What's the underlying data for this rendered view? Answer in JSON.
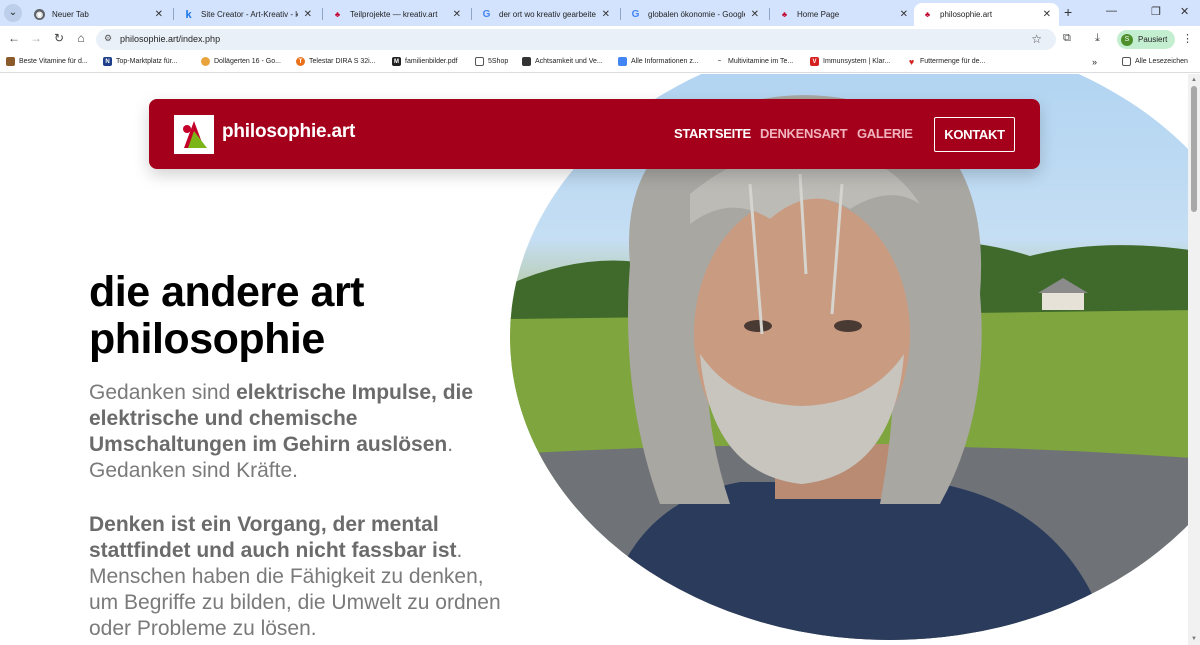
{
  "browser": {
    "tabs": [
      {
        "title": "Neuer Tab",
        "favicon": "chrome-icon",
        "active": false
      },
      {
        "title": "Site Creator - Art-Kreativ - krea",
        "favicon": "k-icon",
        "active": false
      },
      {
        "title": "Teilprojekte — kreativ.art",
        "favicon": "kreativ-icon",
        "active": false
      },
      {
        "title": "der ort wo kreativ gearbeitet w",
        "favicon": "google-icon",
        "active": false
      },
      {
        "title": "globalen ökonomie - Google S",
        "favicon": "google-icon",
        "active": false
      },
      {
        "title": "Home Page",
        "favicon": "kreativ-icon",
        "active": false
      },
      {
        "title": "philosophie.art",
        "favicon": "kreativ-icon",
        "active": true
      }
    ],
    "url": "philosophie.art/index.php",
    "profile_label": "Pausiert",
    "profile_initial": "S",
    "all_bookmarks_label": "Alle Lesezeichen",
    "bookmarks": [
      {
        "label": "Beste Vitamine für d...",
        "color": "#8a5a2b"
      },
      {
        "label": "Top-Marktplatz für...",
        "color": "#1f3f8a"
      },
      {
        "label": "Dollägerten 16 - Go...",
        "color": "#e8a33a"
      },
      {
        "label": "Telestar DIRA S 32i...",
        "color": "#e8711a"
      },
      {
        "label": "familienbilder.pdf",
        "color": "#222222"
      },
      {
        "label": "5Shop",
        "color": "#555555"
      },
      {
        "label": "Achtsamkeit und Ve...",
        "color": "#333333"
      },
      {
        "label": "Alle Informationen z...",
        "color": "#4285f4"
      },
      {
        "label": "Multivitamine im Te...",
        "color": "#555555"
      },
      {
        "label": "Immunsystem | Klar...",
        "color": "#d62020"
      },
      {
        "label": "Futtermenge für de...",
        "color": "#d62020"
      }
    ]
  },
  "site": {
    "logo_text": "philosophie.art",
    "nav": [
      {
        "label": "STARTSEITE",
        "color": "#ffffff"
      },
      {
        "label": "DENKENSART",
        "color": "#f1b3bd"
      },
      {
        "label": "GALERIE",
        "color": "#f1b3bd"
      }
    ],
    "cta_label": "KONTAKT",
    "brand_color": "#a5001b"
  },
  "hero": {
    "headline": "die andere art philosophie",
    "para1_bold": "elektrische Impulse, die elektrische und chemische Umschaltungen im Gehirn auslösen",
    "para1_pre": "Gedanken sind ",
    "para1_post": ". Gedanken sind Kräfte.",
    "para2_bold": "Denken ist ein Vorgang, der mental stattfindet und auch nicht fassbar ist",
    "para2_post": ". Menschen haben die Fähigkeit zu denken, um Begriffe zu bilden, die Umwelt zu ordnen oder Probleme zu lösen."
  }
}
